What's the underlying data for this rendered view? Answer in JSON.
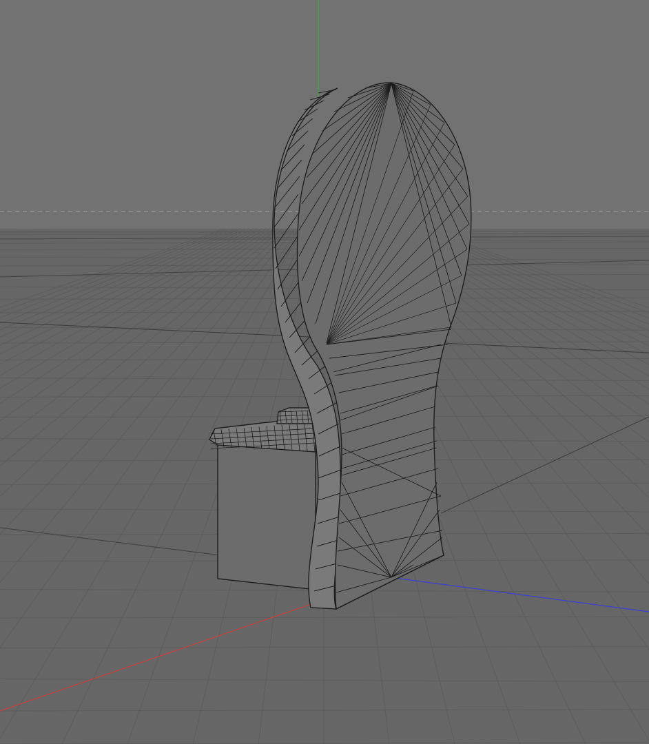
{
  "viewport": {
    "view": "perspective",
    "background_color": "#707070",
    "sky_color": "#727272",
    "floor_color": "#666666",
    "grid_visible": true,
    "grid_line_color": "#5b5b5b",
    "horizon_line_color": "#9a9a9a",
    "axes": {
      "x_color": "#c8413d",
      "y_color": "#3fae3f",
      "z_color": "#3a3fd0"
    }
  },
  "model": {
    "object": "chair",
    "display_mode": "shaded-with-wireframe",
    "face_color": "#6c6c6c",
    "side_face_color": "#7a7a7a",
    "edge_color": "#1e1e1e"
  }
}
